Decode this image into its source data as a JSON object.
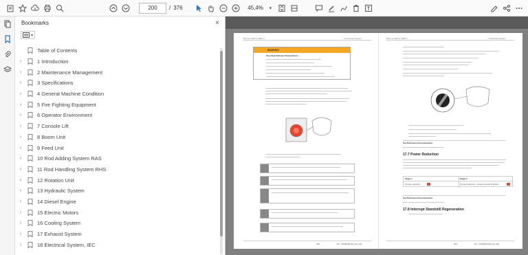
{
  "toolbar": {
    "page_current": "200",
    "page_separator": "/",
    "page_total": "376",
    "zoom": "45,4%",
    "accent": "#2a73c8"
  },
  "panel": {
    "title": "Bookmarks",
    "close": "×"
  },
  "bookmarks": [
    {
      "label": "Table of Contents",
      "arrow": ""
    },
    {
      "label": "1 Introduction",
      "arrow": "›"
    },
    {
      "label": "2 Maintenance Management",
      "arrow": "›"
    },
    {
      "label": "3 Specifications",
      "arrow": "›"
    },
    {
      "label": "4 General Machine Condition",
      "arrow": "›"
    },
    {
      "label": "5 Fire Fighting Equipment",
      "arrow": "›"
    },
    {
      "label": "6 Operator Environment",
      "arrow": "›"
    },
    {
      "label": "7 Console Lift",
      "arrow": "›"
    },
    {
      "label": "8 Boom Unit",
      "arrow": "›"
    },
    {
      "label": "9 Feed Unit",
      "arrow": "›"
    },
    {
      "label": "10 Rod Adding System RAS",
      "arrow": "›"
    },
    {
      "label": "11 Rod Handling System RHS",
      "arrow": "›"
    },
    {
      "label": "12 Rotation Unit",
      "arrow": "›"
    },
    {
      "label": "13 Hydraulic System",
      "arrow": "›"
    },
    {
      "label": "14 Diesel Engine",
      "arrow": "›"
    },
    {
      "label": "15 Electric Motors",
      "arrow": "›"
    },
    {
      "label": "16 Cooling System",
      "arrow": "›"
    },
    {
      "label": "17 Exhaust System",
      "arrow": "›"
    },
    {
      "label": "18 Electrical System, IEC",
      "arrow": "›"
    }
  ],
  "doc": {
    "left_header_left": "Boomer XE3 C, WE3 C",
    "left_header_right": "17 Exhaust System",
    "right_header_left": "Boomer XE3 C, WE3 C",
    "right_header_right": "17 Exhaust System",
    "warning_title": "WARNING",
    "warning_sub": "Very High Exhaust Temperatures",
    "section_177": "17.7 Power Reduction",
    "section_178": "17.8 Interrupt Standstill Regeneration",
    "see_ref_1": "See Reference Documentation",
    "see_ref_2": "See Reference Documentation",
    "stage1": "Stage 1",
    "stage2": "Stage 2",
    "torque1": "Torque reduction",
    "torque2": "Torque reduction + Engine speed limitation",
    "footer_left_pg": "200",
    "footer_right_pg": "201",
    "footer_doc": "No. TT000000.001 (en-US)"
  }
}
